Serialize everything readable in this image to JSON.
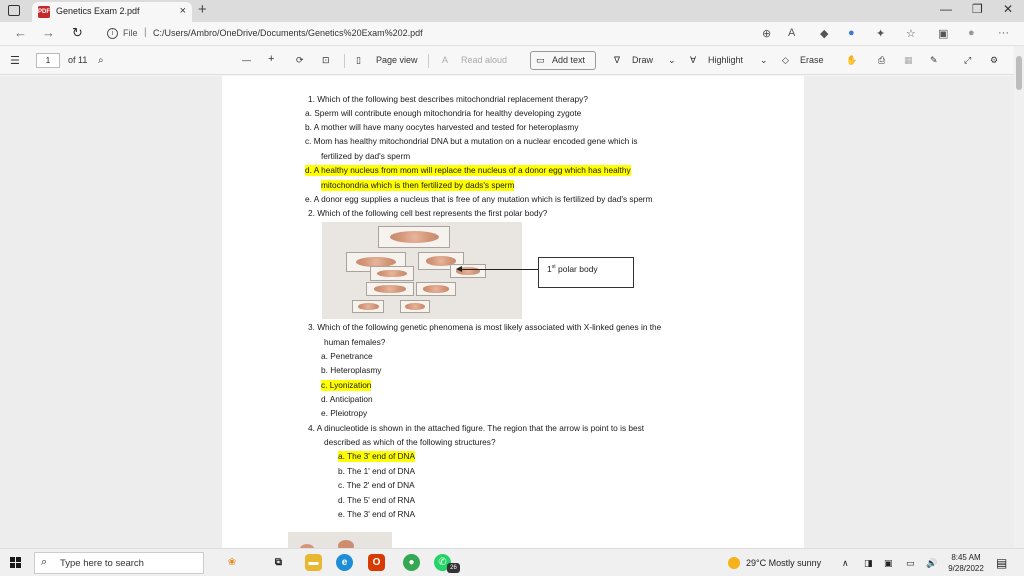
{
  "browser": {
    "tab_title": "Genetics Exam 2.pdf",
    "tab_close": "×",
    "new_tab": "+",
    "pdf_icon_text": "PDF",
    "url_scheme": "File",
    "url_path": "C:/Users/Ambro/OneDrive/Documents/Genetics%20Exam%202.pdf",
    "window_controls": {
      "minimize": "—",
      "maximize": "❐",
      "close": "✕"
    },
    "more_label": "···"
  },
  "pdf_toolbar": {
    "current_page": "1",
    "page_count": "of 11",
    "zoom_out": "—",
    "zoom_in": "+",
    "page_view": "Page view",
    "read_aloud": "Read aloud",
    "add_text": "Add text",
    "draw": "Draw",
    "highlight": "Highlight",
    "erase": "Erase"
  },
  "document": {
    "lines": [
      {
        "text": "1.   Which of the following best describes mitochondrial replacement therapy?",
        "highlight": false
      },
      {
        "text": "a.   Sperm will contribute enough mitochondria for healthy developing zygote",
        "highlight": false
      },
      {
        "text": "b.   A mother will have many oocytes harvested and tested for heteroplasmy",
        "highlight": false
      },
      {
        "text": "c.   Mom has healthy mitochondrial DNA but a mutation on a nuclear encoded gene which is",
        "highlight": false
      },
      {
        "text": "fertilized by dad's sperm",
        "highlight": false
      },
      {
        "text": "d.   A healthy nucleus from mom will replace the nucleus of a donor egg which has healthy",
        "highlight": true
      },
      {
        "text": "mitochondria which is then fertilized by dads's sperm",
        "highlight": true
      },
      {
        "text": "e.   A donor egg supplies a nucleus that is free of any mutation which is fertilized by dad's sperm",
        "highlight": false
      },
      {
        "text": "2.   Which of the following cell best represents the first polar body?",
        "highlight": false
      },
      {
        "text": "3.   Which of the following genetic phenomena is most likely associated with X-linked genes in the",
        "highlight": false
      },
      {
        "text": "human females?",
        "highlight": false
      },
      {
        "text": "a.   Penetrance",
        "highlight": false
      },
      {
        "text": "b.   Heteroplasmy",
        "highlight": false
      },
      {
        "text": "c.   Lyonization",
        "highlight": true
      },
      {
        "text": "d.   Anticipation",
        "highlight": false
      },
      {
        "text": "e.   Pleiotropy",
        "highlight": false
      },
      {
        "text": "4.   A dinucleotide is shown in the attached figure. The region that the arrow is point to is best",
        "highlight": false
      },
      {
        "text": "described as which of the following structures?",
        "highlight": false
      },
      {
        "text": "a.   The 3' end of DNA",
        "highlight": true
      },
      {
        "text": "b.   The 1' end of DNA",
        "highlight": false
      },
      {
        "text": "c.   The 2' end of DNA",
        "highlight": false
      },
      {
        "text": "d.   The 5' end of RNA",
        "highlight": false
      },
      {
        "text": "e.   The 3' end of RNA",
        "highlight": false
      }
    ],
    "figure_label_sup": "st",
    "figure_label_num": "1",
    "figure_label_text": " polar body"
  },
  "taskbar": {
    "search_placeholder": "Type here to search",
    "weather": "29°C  Mostly sunny",
    "time": "8:45 AM",
    "date": "9/28/2022",
    "whatsapp_badge": "26"
  },
  "colors": {
    "highlight": "#ffff00",
    "pdf_red": "#c52828"
  }
}
